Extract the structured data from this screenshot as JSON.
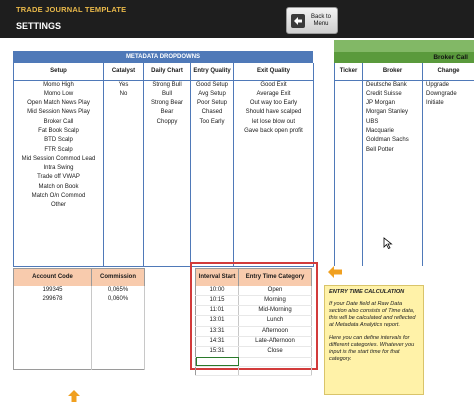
{
  "header": {
    "app_title": "TRADE JOURNAL TEMPLATE",
    "page_title": "SETTINGS",
    "back_button_label": "Back to Menu",
    "back_icon": "back-arrow-icon"
  },
  "metadata": {
    "banner": "METADATA DROPDOWNS",
    "headers": [
      "Setup",
      "Catalyst",
      "Daily Chart",
      "Entry Quality",
      "Exit Quality"
    ],
    "rows": [
      [
        "Momo High",
        "Yes",
        "Strong Bull",
        "Good Setup",
        "Good Exit"
      ],
      [
        "Momo Low",
        "No",
        "Bull",
        "Avg Setup",
        "Average Exit"
      ],
      [
        "Open Match News Play",
        "",
        "Strong Bear",
        "Poor Setup",
        "Out way too Early"
      ],
      [
        "Mid Session News Play",
        "",
        "Bear",
        "Chased",
        "Should have scalped"
      ],
      [
        "Broker Call",
        "",
        "Choppy",
        "Too Early",
        "let lose blow out"
      ],
      [
        "Fat Book Scalp",
        "",
        "",
        "",
        "Gave back open profit"
      ],
      [
        "BTD Scalp",
        "",
        "",
        "",
        ""
      ],
      [
        "FTR Scalp",
        "",
        "",
        "",
        ""
      ],
      [
        "Mid Session Commod Lead",
        "",
        "",
        "",
        ""
      ],
      [
        "Intra Swing",
        "",
        "",
        "",
        ""
      ],
      [
        "Trade off VWAP",
        "",
        "",
        "",
        ""
      ],
      [
        "Match on Book",
        "",
        "",
        "",
        ""
      ],
      [
        "Match O/n Commod",
        "",
        "",
        "",
        ""
      ],
      [
        "Other",
        "",
        "",
        "",
        ""
      ]
    ]
  },
  "broker": {
    "title": "Broker Call",
    "headers": [
      "Ticker",
      "Broker",
      "Change"
    ],
    "rows": [
      [
        "",
        "Deutsche Bank",
        "Upgrade"
      ],
      [
        "",
        "Credit Suisse",
        "Downgrade"
      ],
      [
        "",
        "JP Morgan",
        "Initiate"
      ],
      [
        "",
        "Morgan Stanley",
        ""
      ],
      [
        "",
        "UBS",
        ""
      ],
      [
        "",
        "Macquarie",
        ""
      ],
      [
        "",
        "Goldman Sachs",
        ""
      ],
      [
        "",
        "Bell Potter",
        ""
      ]
    ]
  },
  "accounts": {
    "headers": [
      "Account Code",
      "Commission"
    ],
    "rows": [
      [
        "199345",
        "0,065%"
      ],
      [
        "299678",
        "0,060%"
      ]
    ]
  },
  "intervals": {
    "headers": [
      "Interval Start",
      "Entry Time Category"
    ],
    "rows": [
      [
        "10:00",
        "Open"
      ],
      [
        "10:15",
        "Morning"
      ],
      [
        "11:01",
        "Mid-Morning"
      ],
      [
        "13:01",
        "Lunch"
      ],
      [
        "13:31",
        "Afternoon"
      ],
      [
        "14:31",
        "Late-Afternoon"
      ],
      [
        "15:31",
        "Close"
      ]
    ]
  },
  "info": {
    "title": "ENTRY TIME CALCULATION",
    "p1": "If your Date field at Raw Data section also consists of Time data, this will be calculated and reflected at Metadata Analytics report.",
    "p2": "Here you can define intervals for different categories. Whatever you input is the start time for that category."
  },
  "colors": {
    "header_bg": "#1e1e1e",
    "title_gold": "#e8b84a",
    "meta_blue": "#4f79b8",
    "broker_green": "#5a9a3c",
    "peach_header": "#f8cbad",
    "highlight_red": "#d23b3b",
    "note_yellow": "#fff2a8",
    "arrow_orange": "#f0a020"
  }
}
